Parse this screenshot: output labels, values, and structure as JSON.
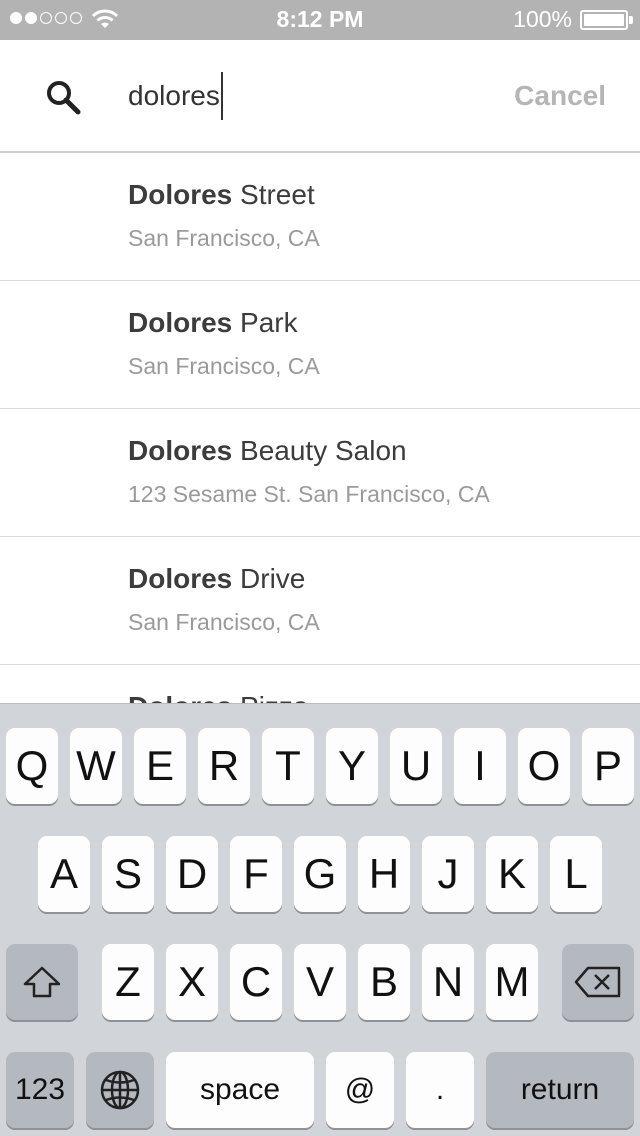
{
  "status_bar": {
    "signal_dots_filled": 2,
    "signal_dots_total": 5,
    "time": "8:12 PM",
    "battery_percent": "100%",
    "battery_level": 1.0
  },
  "search": {
    "query": "dolores",
    "cancel_label": "Cancel"
  },
  "results": [
    {
      "match": "Dolores",
      "rest": " Street",
      "subtitle": "San Francisco, CA"
    },
    {
      "match": "Dolores",
      "rest": " Park",
      "subtitle": "San Francisco, CA"
    },
    {
      "match": "Dolores",
      "rest": " Beauty Salon",
      "subtitle": "123 Sesame St. San Francisco, CA"
    },
    {
      "match": "Dolores",
      "rest": " Drive",
      "subtitle": "San Francisco, CA"
    },
    {
      "match": "Dolores",
      "rest": " Pizza",
      "subtitle": ""
    }
  ],
  "keyboard": {
    "row1": [
      "Q",
      "W",
      "E",
      "R",
      "T",
      "Y",
      "U",
      "I",
      "O",
      "P"
    ],
    "row2": [
      "A",
      "S",
      "D",
      "F",
      "G",
      "H",
      "J",
      "K",
      "L"
    ],
    "row3": [
      "Z",
      "X",
      "C",
      "V",
      "B",
      "N",
      "M"
    ],
    "numbers_label": "123",
    "space_label": "space",
    "at_label": "@",
    "period_label": ".",
    "return_label": "return",
    "shift_icon": "shift-icon",
    "delete_icon": "backspace-icon",
    "globe_icon": "globe-icon"
  },
  "colors": {
    "status_bar": "#b3b3b3",
    "keyboard_bg": "#d1d4d9",
    "cancel": "#b5b5b5"
  }
}
